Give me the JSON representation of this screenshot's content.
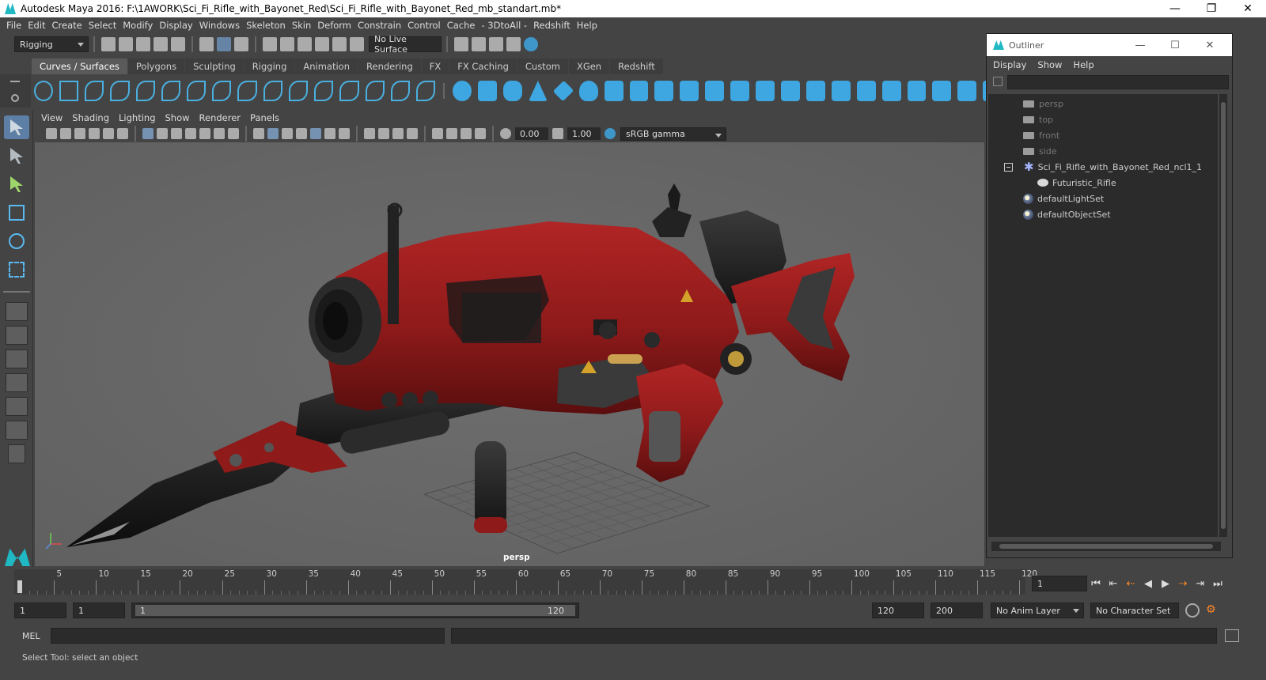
{
  "window": {
    "title": "Autodesk Maya 2016: F:\\1AWORK\\Sci_Fi_Rifle_with_Bayonet_Red\\Sci_Fi_Rifle_with_Bayonet_Red_mb_standart.mb*",
    "minimize": "—",
    "maximize": "❐",
    "close": "✕"
  },
  "menubar": [
    "File",
    "Edit",
    "Create",
    "Select",
    "Modify",
    "Display",
    "Windows",
    "Skeleton",
    "Skin",
    "Deform",
    "Constrain",
    "Control",
    "Cache",
    "- 3DtoAll -",
    "Redshift",
    "Help"
  ],
  "statusline": {
    "menu_set": "Rigging",
    "live_surface": "No Live Surface"
  },
  "shelf_tabs": [
    "Curves / Surfaces",
    "Polygons",
    "Sculpting",
    "Rigging",
    "Animation",
    "Rendering",
    "FX",
    "FX Caching",
    "Custom",
    "XGen",
    "Redshift"
  ],
  "shelf_active_tab": "Curves / Surfaces",
  "viewport": {
    "menu": [
      "View",
      "Shading",
      "Lighting",
      "Show",
      "Renderer",
      "Panels"
    ],
    "exposure": "0.00",
    "gamma": "1.00",
    "color_space": "sRGB gamma",
    "camera_label": "persp"
  },
  "outliner": {
    "title": "Outliner",
    "menu": [
      "Display",
      "Show",
      "Help"
    ],
    "items": [
      {
        "label": "persp",
        "type": "camera"
      },
      {
        "label": "top",
        "type": "camera"
      },
      {
        "label": "front",
        "type": "camera"
      },
      {
        "label": "side",
        "type": "camera"
      },
      {
        "label": "Sci_Fi_Rifle_with_Bayonet_Red_ncl1_1",
        "type": "group"
      },
      {
        "label": "Futuristic_Rifle",
        "type": "mesh"
      },
      {
        "label": "defaultLightSet",
        "type": "set"
      },
      {
        "label": "defaultObjectSet",
        "type": "set"
      }
    ]
  },
  "timeline": {
    "ticks": [
      "5",
      "10",
      "15",
      "20",
      "25",
      "30",
      "35",
      "40",
      "45",
      "50",
      "55",
      "60",
      "65",
      "70",
      "75",
      "80",
      "85",
      "90",
      "95",
      "100",
      "105",
      "110",
      "115",
      "120"
    ],
    "start_label": "1",
    "current_frame": "1"
  },
  "range": {
    "start": "1",
    "playback_start": "1",
    "slider_start": "1",
    "slider_end": "120",
    "playback_end": "120",
    "end": "200",
    "anim_layer": "No Anim Layer",
    "character_set": "No Character Set"
  },
  "command": {
    "label": "MEL"
  },
  "help_line": "Select Tool: select an object",
  "colors": {
    "accent": "#1fb8c3",
    "shelf_icon": "#3ea6e0",
    "rifle_red": "#8e1a1a",
    "highlight": "#ff8a26"
  }
}
